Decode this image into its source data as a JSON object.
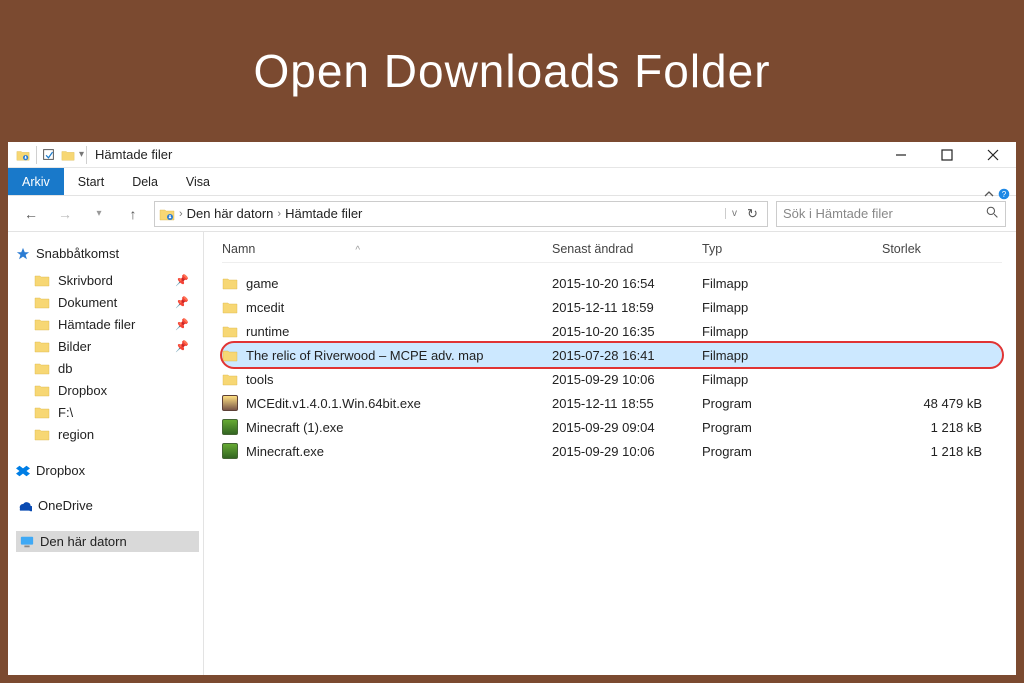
{
  "banner": {
    "title": "Open Downloads Folder"
  },
  "titlebar": {
    "title": "Hämtade filer"
  },
  "ribbon": {
    "file": "Arkiv",
    "tabs": [
      "Start",
      "Dela",
      "Visa"
    ]
  },
  "breadcrumb": {
    "segments": [
      "Den här datorn",
      "Hämtade filer"
    ]
  },
  "search": {
    "placeholder": "Sök i Hämtade filer"
  },
  "sidebar": {
    "quick_access_label": "Snabbåtkomst",
    "quick_items": [
      {
        "label": "Skrivbord",
        "pinned": true
      },
      {
        "label": "Dokument",
        "pinned": true
      },
      {
        "label": "Hämtade filer",
        "pinned": true
      },
      {
        "label": "Bilder",
        "pinned": true
      },
      {
        "label": "db",
        "pinned": false
      },
      {
        "label": "Dropbox",
        "pinned": false
      },
      {
        "label": "F:\\",
        "pinned": false
      },
      {
        "label": "region",
        "pinned": false
      }
    ],
    "dropbox_label": "Dropbox",
    "onedrive_label": "OneDrive",
    "thispc_label": "Den här datorn"
  },
  "columns": {
    "name": "Namn",
    "modified": "Senast ändrad",
    "type": "Typ",
    "size": "Storlek"
  },
  "files": [
    {
      "name": "game",
      "modified": "2015-10-20 16:54",
      "type": "Filmapp",
      "size": "",
      "icon": "folder",
      "highlight": false
    },
    {
      "name": "mcedit",
      "modified": "2015-12-11 18:59",
      "type": "Filmapp",
      "size": "",
      "icon": "folder",
      "highlight": false
    },
    {
      "name": "runtime",
      "modified": "2015-10-20 16:35",
      "type": "Filmapp",
      "size": "",
      "icon": "folder",
      "highlight": false
    },
    {
      "name": "The relic of Riverwood – MCPE adv. map",
      "modified": "2015-07-28 16:41",
      "type": "Filmapp",
      "size": "",
      "icon": "folder",
      "highlight": true
    },
    {
      "name": "tools",
      "modified": "2015-09-29 10:06",
      "type": "Filmapp",
      "size": "",
      "icon": "folder",
      "highlight": false
    },
    {
      "name": "MCEdit.v1.4.0.1.Win.64bit.exe",
      "modified": "2015-12-11 18:55",
      "type": "Program",
      "size": "48 479 kB",
      "icon": "mcedit",
      "highlight": false
    },
    {
      "name": "Minecraft (1).exe",
      "modified": "2015-09-29 09:04",
      "type": "Program",
      "size": "1 218 kB",
      "icon": "exe",
      "highlight": false
    },
    {
      "name": "Minecraft.exe",
      "modified": "2015-09-29 10:06",
      "type": "Program",
      "size": "1 218 kB",
      "icon": "exe",
      "highlight": false
    }
  ]
}
